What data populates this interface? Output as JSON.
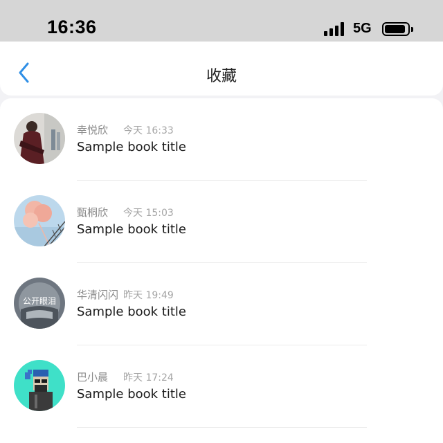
{
  "status_bar": {
    "time": "16:36",
    "network": "5G",
    "icons": [
      "signal-icon",
      "battery-icon"
    ]
  },
  "nav": {
    "title": "收藏",
    "back_icon": "chevron-left-icon",
    "accent": "#2f8fe6"
  },
  "favorites": [
    {
      "user": "幸悦欣",
      "time": "今天 16:33",
      "content": "Sample book title"
    },
    {
      "user": "甄桐欣",
      "time": "今天 15:03",
      "content": "Sample book title"
    },
    {
      "user": "华清闪闪",
      "time": "昨天 19:49",
      "content": "Sample book title",
      "avatar_text": "公开眼泪"
    },
    {
      "user": "巴小晨",
      "time": "昨天 17:24",
      "content": "Sample book title"
    }
  ]
}
